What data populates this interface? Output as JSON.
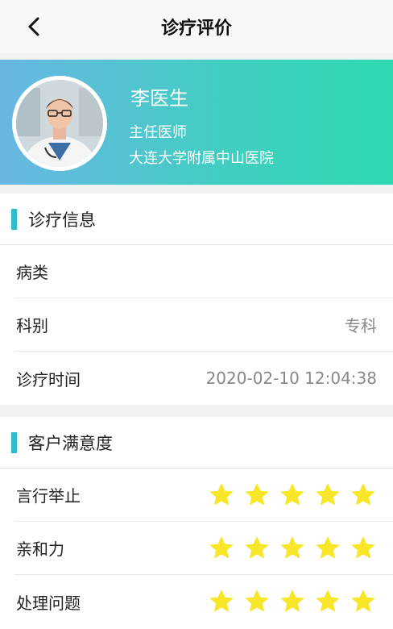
{
  "header": {
    "title": "诊疗评价"
  },
  "doctor": {
    "name": "李医生",
    "title": "主任医师",
    "hospital": "大连大学附属中山医院"
  },
  "diagnosis": {
    "section_title": "诊疗信息",
    "rows": [
      {
        "label": "病类",
        "value": ""
      },
      {
        "label": "科别",
        "value": "专科"
      },
      {
        "label": "诊疗时间",
        "value": "2020-02-10 12:04:38"
      }
    ]
  },
  "satisfaction": {
    "section_title": "客户满意度",
    "rows": [
      {
        "label": "言行举止",
        "rating": 5,
        "max": 5
      },
      {
        "label": "亲和力",
        "rating": 5,
        "max": 5
      },
      {
        "label": "处理问题",
        "rating": 5,
        "max": 5
      }
    ]
  },
  "colors": {
    "accent": "#2bbcd0",
    "star": "#f7e62a",
    "gradient_start": "#69b6e3",
    "gradient_end": "#2fd9b0"
  },
  "icons": {
    "back": "chevron-left-icon",
    "star": "star-icon",
    "avatar": "doctor-photo"
  }
}
